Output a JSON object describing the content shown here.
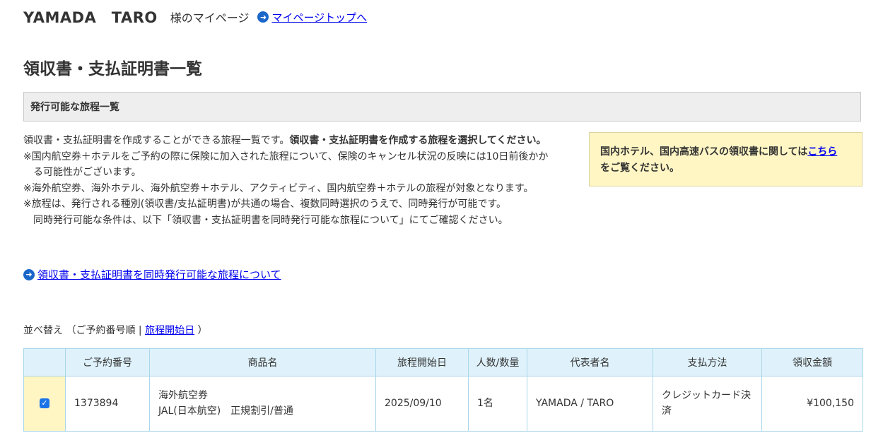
{
  "header": {
    "user_name": "YAMADA　TARO",
    "page_suffix": "様のマイページ",
    "top_link": "マイページトップへ",
    "top_link_icon": "arrow-right-circle-icon"
  },
  "page_title": "領収書・支払証明書一覧",
  "section_title": "発行可能な旅程一覧",
  "description": {
    "line1_normal": "領収書・支払証明書を作成することができる旅程一覧です。",
    "line1_bold": "領収書・支払証明書を作成する旅程を選択してください。",
    "line2": "※国内航空券＋ホテルをご予約の際に保険に加入された旅程について、保険のキャンセル状況の反映には10日前後かか",
    "line3": "る可能性がございます。",
    "line4": "※海外航空券、海外ホテル、海外航空券＋ホテル、アクティビティ、国内航空券＋ホテルの旅程が対象となります。",
    "line5": "※旅程は、発行される種別(領収書/支払証明書)が共通の場合、複数同時選択のうえで、同時発行が可能です。",
    "line6": "同時発行可能な条件は、以下「領収書・支払証明書を同時発行可能な旅程について」にてご確認ください。"
  },
  "notice": {
    "text": "国内ホテル、国内高速バスの領収書に関しては",
    "link": "こちら",
    "text2": "をご覧ください。",
    "bg_color": "#fff6c4"
  },
  "about_link": "領収書・支払証明書を同時発行可能な旅程について",
  "sort": {
    "label": "並べ替え",
    "open": "（",
    "current": "ご予約番号順",
    "separator": "|",
    "option": "旅程開始日",
    "close": "）"
  },
  "table": {
    "headers": [
      "",
      "ご予約番号",
      "商品名",
      "旅程開始日",
      "人数/数量",
      "代表者名",
      "支払方法",
      "領収金額"
    ],
    "rows": [
      {
        "checked": true,
        "booking_no": "1373894",
        "product_line1": "海外航空券",
        "product_line2": "JAL(日本航空)　正規割引/普通",
        "start_date": "2025/09/10",
        "quantity": "1名",
        "representative": "YAMADA / TARO",
        "payment": "クレジットカード決済",
        "amount": "¥100,150"
      }
    ]
  },
  "colors": {
    "header_bg": "#dff2fb",
    "table_border": "#a9d6ea",
    "link": "#0000ee",
    "icon_blue": "#1a66c9",
    "checkbox": "#1a73e8"
  }
}
